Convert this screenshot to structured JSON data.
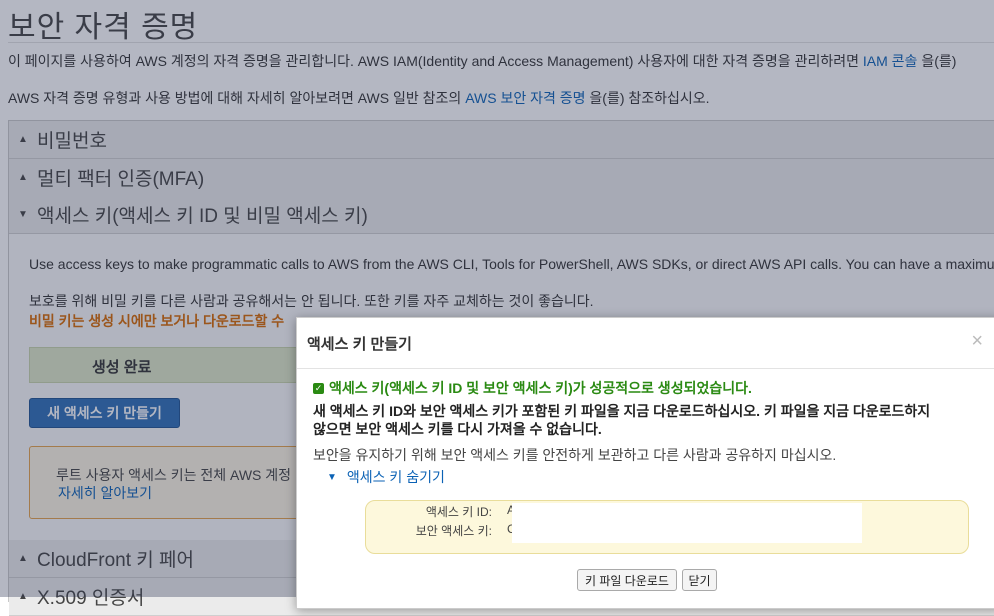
{
  "page": {
    "title": "보안 자격 증명",
    "intro_prefix": "이 페이지를 사용하여 AWS 계정의 자격 증명을 관리합니다. AWS IAM(Identity and Access Management) 사용자에 대한 자격 증명을 관리하려면",
    "intro_link": "IAM 콘솔",
    "intro_suffix": "을(를)",
    "ref_prefix": "AWS 자격 증명 유형과 사용 방법에 대해 자세히 알아보려면 AWS 일반 참조의",
    "ref_link": "AWS 보안 자격 증명",
    "ref_suffix": "을(를) 참조하십시오."
  },
  "accordion": {
    "password": "비밀번호",
    "mfa": "멀티 팩터 인증(MFA)",
    "access_keys": "액세스 키(액세스 키 ID 및 비밀 액세스 키)",
    "cloudfront": "CloudFront 키 페어",
    "x509": "X.509 인증서"
  },
  "access_keys_section": {
    "desc": "Use access keys to make programmatic calls to AWS from the AWS CLI, Tools for PowerShell, AWS SDKs, or direct AWS API calls. You can have a maximum",
    "protect": "보호를 위해 비밀 키를 다른 사람과 공유해서는 안 됩니다. 또한 키를 자주 교체하는 것이 좋습니다.",
    "warning": "비밀 키는 생성 시에만 보거나 다운로드할 수",
    "status": "생성 완료",
    "create_button": "새 액세스 키 만들기",
    "notice_text": "루트 사용자 액세스 키는 전체 AWS 계정",
    "notice_link": "자세히 알아보기"
  },
  "modal": {
    "title": "액세스 키 만들기",
    "close": "×",
    "success": "액세스 키(액세스 키 ID 및 보안 액세스 키)가 성공적으로 생성되었습니다.",
    "bold1": "새 액세스 키 ID와 보안 액세스 키가 포함된 키 파일을 지금 다운로드하십시오. 키 파일을 지금 다운로드하지",
    "bold2": "않으면 보안 액세스 키를 다시 가져올 수 없습니다.",
    "info": "보안을 유지하기 위해 보안 액세스 키를 안전하게 보관하고 다른 사람과 공유하지 마십시오.",
    "toggle": "액세스 키 숨기기",
    "key_id_label": "액세스 키 ID:",
    "key_id_value": "A",
    "secret_label": "보안 액세스 키:",
    "secret_value": "C",
    "download_button": "키 파일 다운로드",
    "close_button": "닫기"
  }
}
